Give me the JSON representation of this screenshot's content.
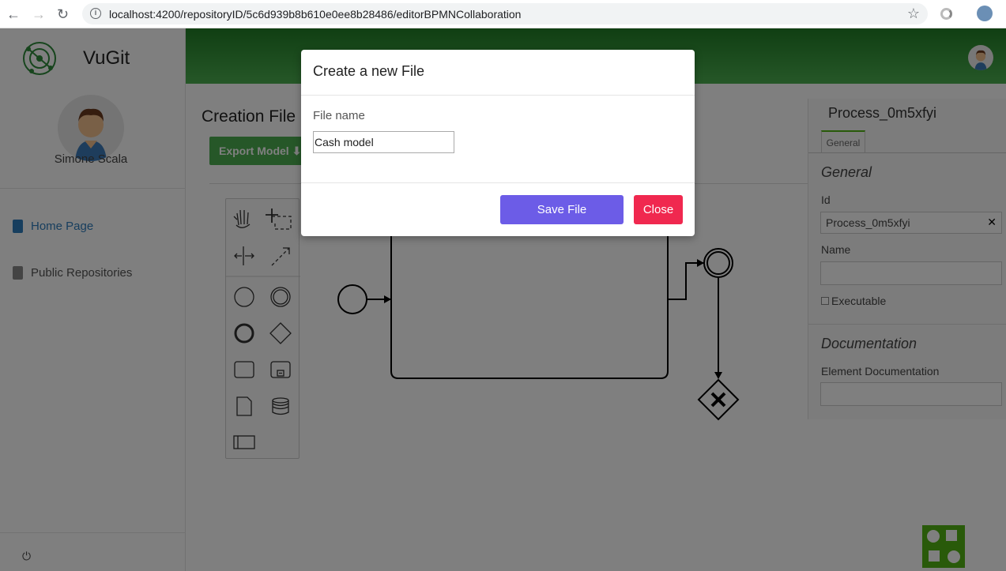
{
  "browser": {
    "url": "localhost:4200/repositoryID/5c6d939b8b610e0ee8b28486/editorBPMNCollaboration"
  },
  "app": {
    "name": "VuGit",
    "brand_color": "#4caf50"
  },
  "sidebar": {
    "user_name": "Simone Scala",
    "items": [
      {
        "label": "Home Page",
        "icon": "document-icon",
        "active": true
      },
      {
        "label": "Public Repositories",
        "icon": "document-icon",
        "active": false
      }
    ],
    "footer_icon": "power-icon"
  },
  "main": {
    "title": "Creation File",
    "export_button": "Export Model"
  },
  "properties": {
    "title": "Process_0m5xfyi",
    "tab": "General",
    "general_heading": "General",
    "id_label": "Id",
    "id_value": "Process_0m5xfyi",
    "name_label": "Name",
    "name_value": "",
    "executable_label": "Executable",
    "documentation_heading": "Documentation",
    "element_documentation_label": "Element Documentation"
  },
  "modal": {
    "title": "Create a new File",
    "field_label": "File name",
    "field_value": "Cash model",
    "save_button": "Save File",
    "close_button": "Close",
    "save_color": "#6c5ce7",
    "close_color": "#f0284f"
  }
}
